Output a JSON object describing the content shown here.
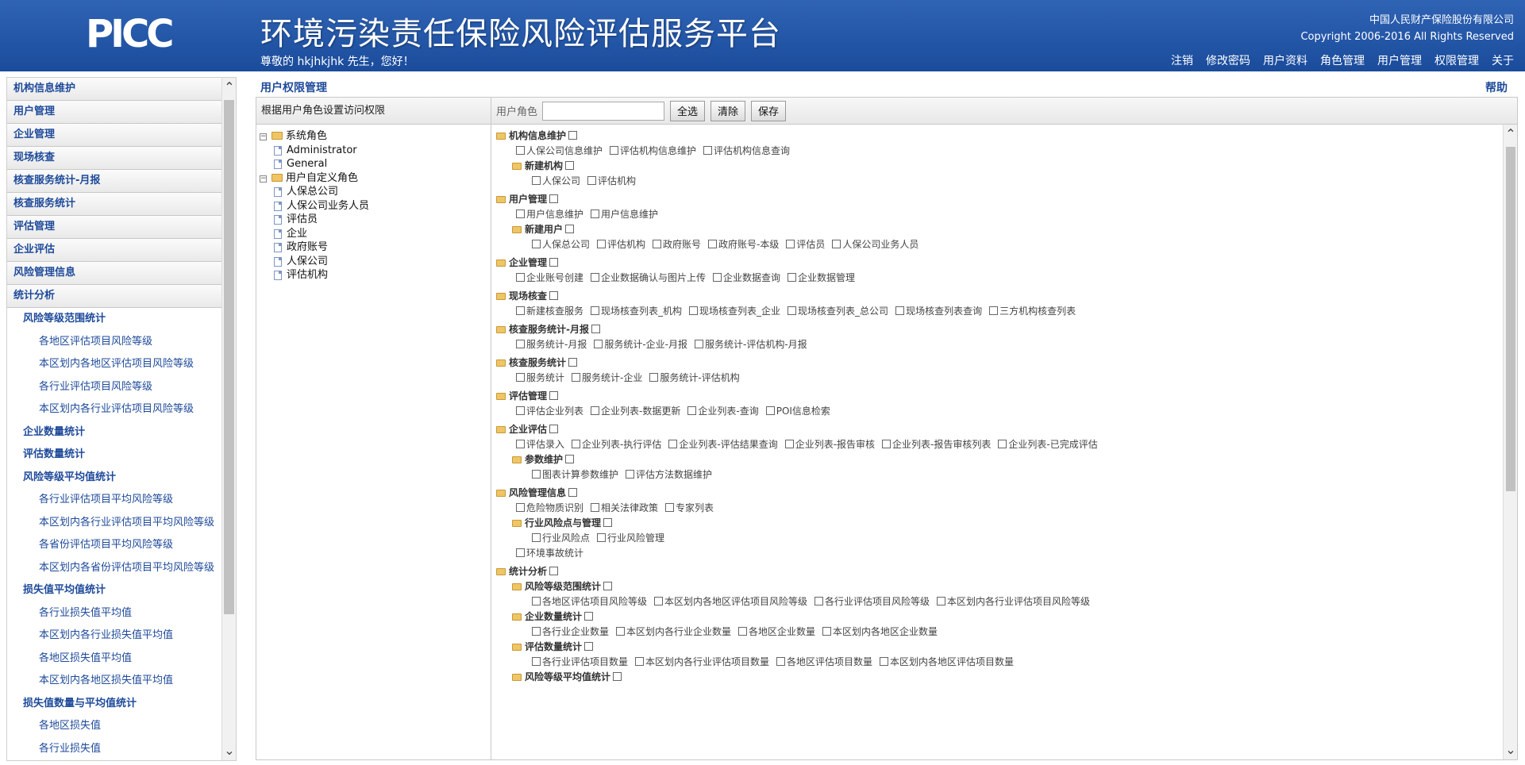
{
  "header": {
    "logo": "PICC",
    "title": "环境污染责任保险风险评估服务平台",
    "greeting": "尊敬的 hkjhkjhk 先生，您好！",
    "company": "中国人民财产保险股份有限公司",
    "copyright": "Copyright 2006-2016 All Rights Reserved",
    "nav": [
      "注销",
      "修改密码",
      "用户资料",
      "角色管理",
      "用户管理",
      "权限管理",
      "关于"
    ]
  },
  "sidebar": {
    "menus": [
      "机构信息维护",
      "用户管理",
      "企业管理",
      "现场核查",
      "核查服务统计-月报",
      "核查服务统计",
      "评估管理",
      "企业评估",
      "风险管理信息",
      "统计分析"
    ],
    "stats": [
      {
        "label": "风险等级范围统计",
        "children": [
          "各地区评估项目风险等级",
          "本区划内各地区评估项目风险等级",
          "各行业评估项目风险等级",
          "本区划内各行业评估项目风险等级"
        ]
      },
      {
        "label": "企业数量统计",
        "children": []
      },
      {
        "label": "评估数量统计",
        "children": []
      },
      {
        "label": "风险等级平均值统计",
        "children": [
          "各行业评估项目平均风险等级",
          "本区划内各行业评估项目平均风险等级",
          "各省份评估项目平均风险等级",
          "本区划内各省份评估项目平均风险等级"
        ]
      },
      {
        "label": "损失值平均值统计",
        "children": [
          "各行业损失值平均值",
          "本区划内各行业损失值平均值",
          "各地区损失值平均值",
          "本区划内各地区损失值平均值"
        ]
      },
      {
        "label": "损失值数量与平均值统计",
        "children": [
          "各地区损失值",
          "各行业损失值"
        ]
      }
    ]
  },
  "main": {
    "title": "用户权限管理",
    "help": "帮助",
    "left_header": "根据用户角色设置访问权限",
    "role_label": "用户角色",
    "role_value": "",
    "buttons": {
      "select_all": "全选",
      "clear": "清除",
      "save": "保存"
    },
    "tree": [
      {
        "label": "系统角色",
        "children": [
          "Administrator",
          "General"
        ]
      },
      {
        "label": "用户自定义角色",
        "children": [
          "人保总公司",
          "人保公司业务人员",
          "评估员",
          "企业",
          "政府账号",
          "人保公司",
          "评估机构"
        ]
      }
    ],
    "permissions": [
      {
        "group": "机构信息维护",
        "items": [
          "人保公司信息维护",
          "评估机构信息维护",
          "评估机构信息查询"
        ],
        "subgroups": [
          {
            "group": "新建机构",
            "items": [
              "人保公司",
              "评估机构"
            ]
          }
        ]
      },
      {
        "group": "用户管理",
        "items": [
          "用户信息维护",
          "用户信息维护"
        ],
        "subgroups": [
          {
            "group": "新建用户",
            "items": [
              "人保总公司",
              "评估机构",
              "政府账号",
              "政府账号-本级",
              "评估员",
              "人保公司业务人员"
            ]
          }
        ]
      },
      {
        "group": "企业管理",
        "items": [
          "企业账号创建",
          "企业数据确认与图片上传",
          "企业数据查询",
          "企业数据管理"
        ],
        "subgroups": []
      },
      {
        "group": "现场核查",
        "items": [
          "新建核查服务",
          "现场核查列表_机构",
          "现场核查列表_企业",
          "现场核查列表_总公司",
          "现场核查列表查询",
          "三方机构核查列表"
        ],
        "subgroups": []
      },
      {
        "group": "核查服务统计-月报",
        "items": [
          "服务统计-月报",
          "服务统计-企业-月报",
          "服务统计-评估机构-月报"
        ],
        "subgroups": []
      },
      {
        "group": "核查服务统计",
        "items": [
          "服务统计",
          "服务统计-企业",
          "服务统计-评估机构"
        ],
        "subgroups": []
      },
      {
        "group": "评估管理",
        "items": [
          "评估企业列表",
          "企业列表-数据更新",
          "企业列表-查询",
          "POI信息检索"
        ],
        "subgroups": []
      },
      {
        "group": "企业评估",
        "items": [
          "评估录入",
          "企业列表-执行评估",
          "企业列表-评估结果查询",
          "企业列表-报告审核",
          "企业列表-报告审核列表",
          "企业列表-已完成评估"
        ],
        "subgroups": [
          {
            "group": "参数维护",
            "items": [
              "图表计算参数维护",
              "评估方法数据维护"
            ]
          }
        ]
      },
      {
        "group": "风险管理信息",
        "items": [
          "危险物质识别",
          "相关法律政策",
          "专家列表"
        ],
        "subgroups": [
          {
            "group": "行业风险点与管理",
            "items": [
              "行业风险点",
              "行业风险管理"
            ]
          }
        ],
        "trailing": [
          "环境事故统计"
        ]
      },
      {
        "group": "统计分析",
        "items": [],
        "subgroups": [
          {
            "group": "风险等级范围统计",
            "items": [
              "各地区评估项目风险等级",
              "本区划内各地区评估项目风险等级",
              "各行业评估项目风险等级",
              "本区划内各行业评估项目风险等级"
            ]
          },
          {
            "group": "企业数量统计",
            "items": [
              "各行业企业数量",
              "本区划内各行业企业数量",
              "各地区企业数量",
              "本区划内各地区企业数量"
            ]
          },
          {
            "group": "评估数量统计",
            "items": [
              "各行业评估项目数量",
              "本区划内各行业评估项目数量",
              "各地区评估项目数量",
              "本区划内各地区评估项目数量"
            ]
          },
          {
            "group": "风险等级平均值统计",
            "items": []
          }
        ]
      }
    ]
  }
}
